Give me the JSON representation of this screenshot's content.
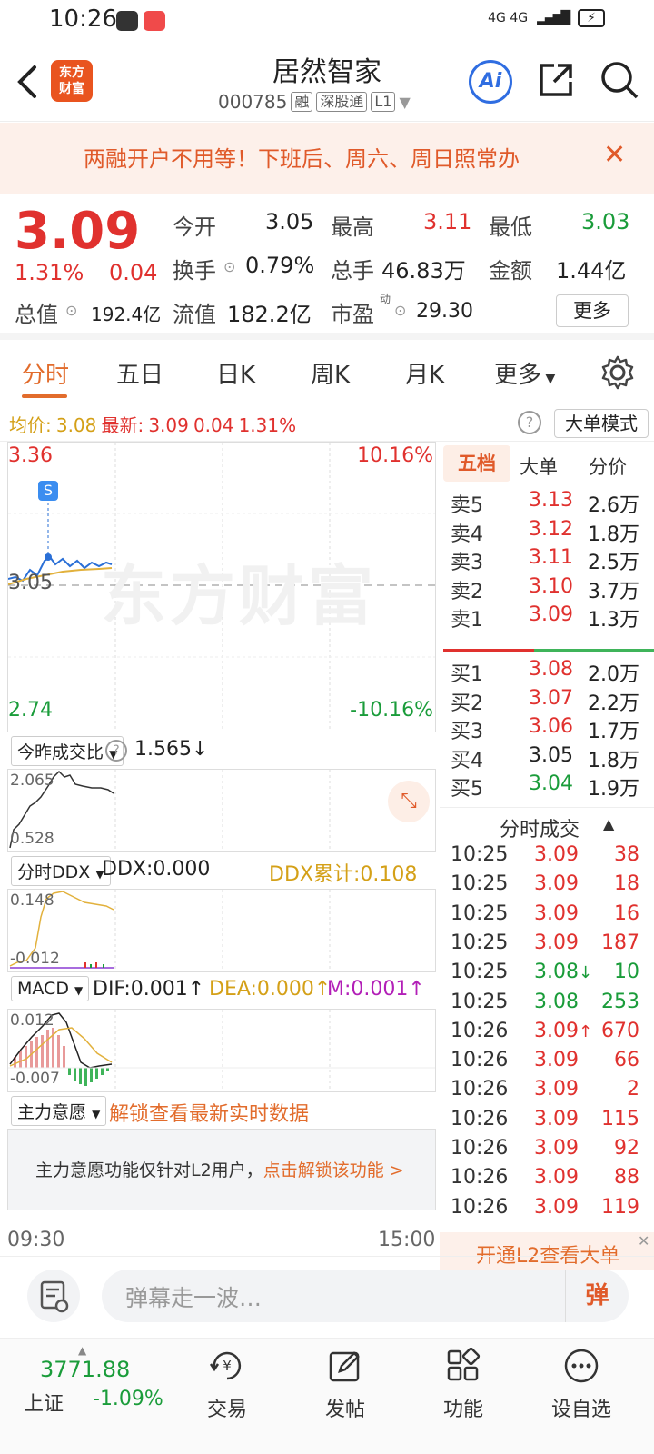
{
  "status_bar": {
    "time": "10:26",
    "network": "4G 4G",
    "battery": "⚡"
  },
  "header": {
    "title": "居然智家",
    "code": "000785",
    "tags": [
      "融",
      "深股通",
      "L1"
    ],
    "logo_text": "东方\n财富",
    "ai_label": "Ai"
  },
  "banner": {
    "text": "两融开户不用等！下班后、周六、周日照常办",
    "close": "✕"
  },
  "quote": {
    "price": "3.09",
    "change_pct": "1.31%",
    "change_abs": "0.04",
    "open_label": "今开",
    "open": "3.05",
    "high_label": "最高",
    "high": "3.11",
    "low_label": "最低",
    "low": "3.03",
    "turnover_label": "换手",
    "turnover": "0.79%",
    "volume_label": "总手",
    "volume": "46.83万",
    "amount_label": "金额",
    "amount": "1.44亿",
    "mktcap_label": "总值",
    "mktcap": "192.4亿",
    "float_label": "流值",
    "float": "182.2亿",
    "pe_label": "市盈",
    "pe_sup": "动",
    "pe": "29.30",
    "more_label": "更多"
  },
  "tabs": [
    "分时",
    "五日",
    "日K",
    "周K",
    "月K",
    "更多"
  ],
  "info_row": {
    "avg_label": "均价:",
    "avg": "3.08",
    "latest_label": "最新:",
    "latest": "3.09",
    "latest_chg": "0.04",
    "latest_pct": "1.31%",
    "mode_label": "大单模式"
  },
  "chart": {
    "y_high": "3.36",
    "y_mid": "3.05",
    "y_low": "2.74",
    "pct_high": "10.16%",
    "pct_low": "-10.16%",
    "watermark": "东方财富",
    "marker": "S",
    "time_start": "09:30",
    "time_end": "15:00"
  },
  "indicators": {
    "vol_ratio": {
      "selector": "今昨成交比",
      "value": "1.565",
      "arrow": "↓",
      "hi": "2.065",
      "lo": "0.528"
    },
    "ddx": {
      "selector": "分时DDX",
      "ddx": "DDX:0.000",
      "cum": "DDX累计:0.108",
      "hi": "0.148",
      "lo": "-0.012"
    },
    "macd": {
      "selector": "MACD",
      "dif": "DIF:0.001",
      "dea": "DEA:0.000",
      "m": "M:0.001",
      "hi": "0.012",
      "lo": "-0.007"
    },
    "main_force": {
      "selector": "主力意愿",
      "unlock": "解锁查看最新实时数据",
      "notice": "主力意愿功能仅针对L2用户，",
      "notice_link": "点击解锁该功能 >"
    }
  },
  "order_book": {
    "tabs": [
      "五档",
      "大单",
      "分价"
    ],
    "asks": [
      {
        "label": "卖5",
        "price": "3.13",
        "vol": "2.6万",
        "color": "red"
      },
      {
        "label": "卖4",
        "price": "3.12",
        "vol": "1.8万",
        "color": "red"
      },
      {
        "label": "卖3",
        "price": "3.11",
        "vol": "2.5万",
        "color": "red"
      },
      {
        "label": "卖2",
        "price": "3.10",
        "vol": "3.7万",
        "color": "red"
      },
      {
        "label": "卖1",
        "price": "3.09",
        "vol": "1.3万",
        "color": "red"
      }
    ],
    "bids": [
      {
        "label": "买1",
        "price": "3.08",
        "vol": "2.0万",
        "color": "red"
      },
      {
        "label": "买2",
        "price": "3.07",
        "vol": "2.2万",
        "color": "red"
      },
      {
        "label": "买3",
        "price": "3.06",
        "vol": "1.7万",
        "color": "red"
      },
      {
        "label": "买4",
        "price": "3.05",
        "vol": "1.8万",
        "color": "black"
      },
      {
        "label": "买5",
        "price": "3.04",
        "vol": "1.9万",
        "color": "green"
      }
    ]
  },
  "trades": {
    "title": "分时成交",
    "rows": [
      {
        "time": "10:25",
        "price": "3.09",
        "arrow": "",
        "vol": "38",
        "vcolor": "red"
      },
      {
        "time": "10:25",
        "price": "3.09",
        "arrow": "",
        "vol": "18",
        "vcolor": "red"
      },
      {
        "time": "10:25",
        "price": "3.09",
        "arrow": "",
        "vol": "16",
        "vcolor": "red"
      },
      {
        "time": "10:25",
        "price": "3.09",
        "arrow": "",
        "vol": "187",
        "vcolor": "red"
      },
      {
        "time": "10:25",
        "price": "3.08",
        "arrow": "↓",
        "vol": "10",
        "vcolor": "green"
      },
      {
        "time": "10:25",
        "price": "3.08",
        "arrow": "",
        "vol": "253",
        "vcolor": "green"
      },
      {
        "time": "10:26",
        "price": "3.09",
        "arrow": "↑",
        "vol": "670",
        "vcolor": "red"
      },
      {
        "time": "10:26",
        "price": "3.09",
        "arrow": "",
        "vol": "66",
        "vcolor": "red"
      },
      {
        "time": "10:26",
        "price": "3.09",
        "arrow": "",
        "vol": "2",
        "vcolor": "red"
      },
      {
        "time": "10:26",
        "price": "3.09",
        "arrow": "",
        "vol": "115",
        "vcolor": "red"
      },
      {
        "time": "10:26",
        "price": "3.09",
        "arrow": "",
        "vol": "92",
        "vcolor": "red"
      },
      {
        "time": "10:26",
        "price": "3.09",
        "arrow": "",
        "vol": "88",
        "vcolor": "red"
      },
      {
        "time": "10:26",
        "price": "3.09",
        "arrow": "",
        "vol": "119",
        "vcolor": "red"
      }
    ],
    "l2_promo": "开通L2查看大单"
  },
  "comment": {
    "placeholder": "弹幕走一波…",
    "danmu": "弹"
  },
  "bottom_nav": {
    "index_value": "3771.88",
    "index_name": "上证",
    "index_pct": "-1.09%",
    "items": [
      "交易",
      "发帖",
      "功能",
      "设自选"
    ]
  }
}
